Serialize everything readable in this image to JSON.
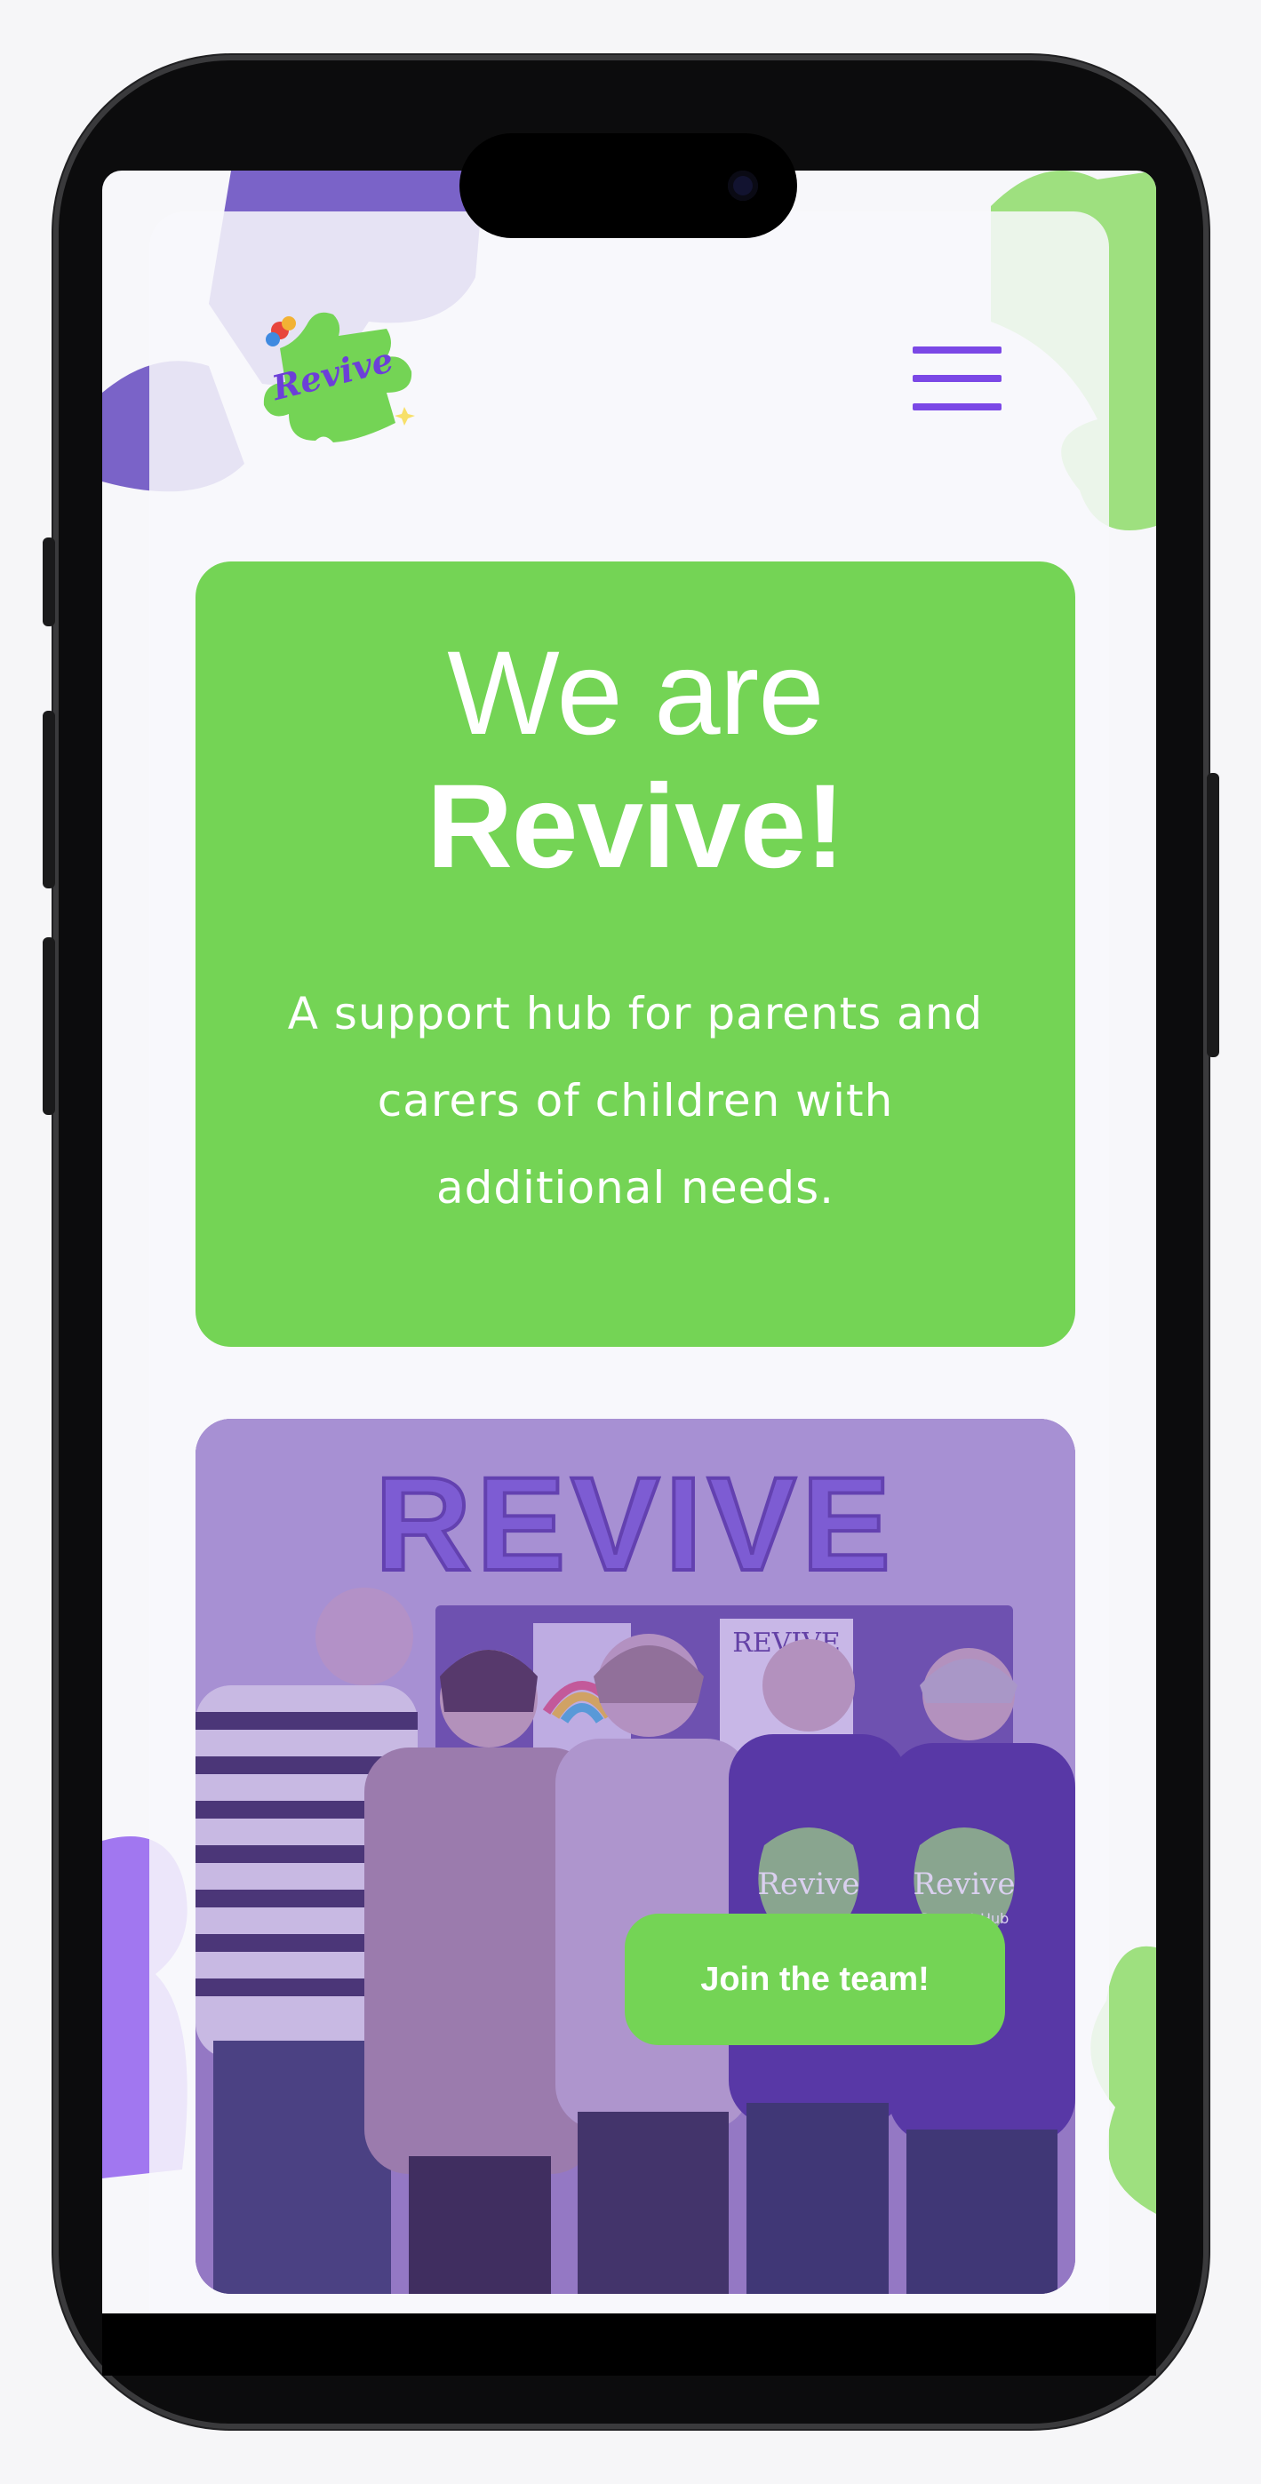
{
  "header": {
    "logo_text": "Revive",
    "menu_icon": "hamburger-menu-icon"
  },
  "hero": {
    "title_line1": "We are",
    "title_line2": "Revive!",
    "subtitle": "A support hub for parents and carers of children with additional needs."
  },
  "photo": {
    "balloon_text": "REVIVE",
    "board_text": "REVIVE",
    "shirt_text": "Revive",
    "shirt_subtext": "Support Hub"
  },
  "cta": {
    "label": "Join the team!"
  },
  "colors": {
    "brand_green": "#74d455",
    "brand_purple": "#7b48e6",
    "photo_overlay": "#7a55c4"
  }
}
